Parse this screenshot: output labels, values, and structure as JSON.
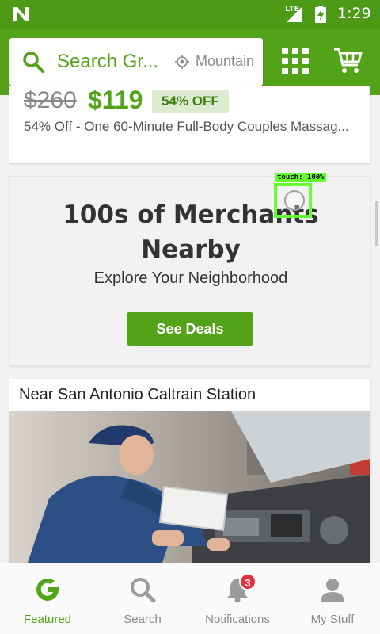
{
  "status_bar": {
    "network_label": "LTE",
    "time": "1:29",
    "icons": [
      "n-logo-icon",
      "signal-icon",
      "battery-charging-icon"
    ]
  },
  "app_bar": {
    "search_text": "Search Gr...",
    "location_text": "Mountain",
    "icons": [
      "search-icon",
      "location-target-icon",
      "grid-icon",
      "cart-icon"
    ]
  },
  "deal_card": {
    "old_price": "$260",
    "new_price": "$119",
    "discount_badge": "54% OFF",
    "description": "54% Off - One 60-Minute Full-Body Couples Massag..."
  },
  "merchants_card": {
    "headline_line1": "100s of Merchants",
    "headline_line2": "Nearby",
    "subheadline": "Explore Your Neighborhood",
    "button_label": "See Deals"
  },
  "touch_overlay": {
    "label": "touch: 100%"
  },
  "near_card": {
    "title": "Near San Antonio Caltrain Station"
  },
  "bottom_nav": {
    "items": [
      {
        "label": "Featured",
        "icon": "groupon-g-icon",
        "active": true
      },
      {
        "label": "Search",
        "icon": "search-icon",
        "active": false
      },
      {
        "label": "Notifications",
        "icon": "bell-icon",
        "active": false,
        "badge": "3"
      },
      {
        "label": "My Stuff",
        "icon": "person-icon",
        "active": false
      }
    ]
  },
  "colors": {
    "brand_green": "#53a318",
    "status_bar_green": "#4d9a17",
    "badge_red": "#e3323b",
    "touch_overlay_green": "#66ff33"
  }
}
